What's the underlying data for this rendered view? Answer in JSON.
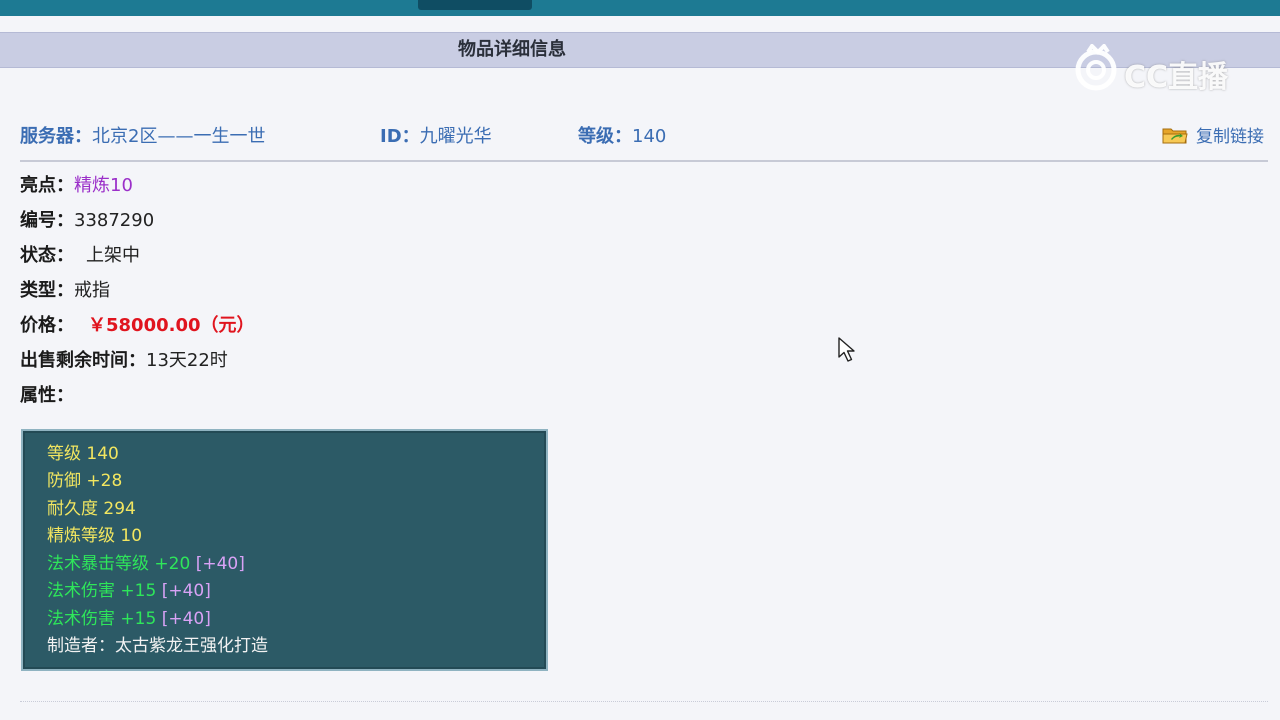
{
  "nav": {
    "active_item": ""
  },
  "header": {
    "title": "物品详细信息"
  },
  "watermark": {
    "text": "CC直播"
  },
  "info": {
    "server_label": "服务器：",
    "server_value": "北京2区——一生一世",
    "id_label": "ID：",
    "id_value": "九曜光华",
    "level_label": "等级：",
    "level_value": "140",
    "copy_link": "复制链接"
  },
  "details": {
    "highlight_label": "亮点：",
    "highlight_value": "精炼10",
    "number_label": "编号：",
    "number_value": "3387290",
    "status_label": "状态：",
    "status_value": "上架中",
    "type_label": "类型：",
    "type_value": "戒指",
    "price_label": "价格：",
    "price_value": "￥58000.00（元）",
    "time_label": "出售剩余时间：",
    "time_value": "13天22时",
    "attr_label": "属性："
  },
  "attributes": {
    "line1": "等级 140",
    "line2": "防御 +28",
    "line3": "耐久度 294",
    "line4": "精炼等级 10",
    "line5_main": "法术暴击等级 +20",
    "line5_bonus": "[+40]",
    "line6_main": "法术伤害 +15",
    "line6_bonus": "[+40]",
    "line7_main": "法术伤害 +15",
    "line7_bonus": "[+40]",
    "line8": "制造者：太古紫龙王强化打造"
  },
  "colors": {
    "nav_bg": "#1d7a93",
    "title_bar": "#c9cde3",
    "link_blue": "#3b6db3",
    "price_red": "#e0141e",
    "highlight_purple": "#9b2fc9",
    "attr_bg": "#2c5a66",
    "attr_yellow": "#f2e660",
    "attr_green": "#2ee65a",
    "attr_pink": "#d8a2f5"
  }
}
